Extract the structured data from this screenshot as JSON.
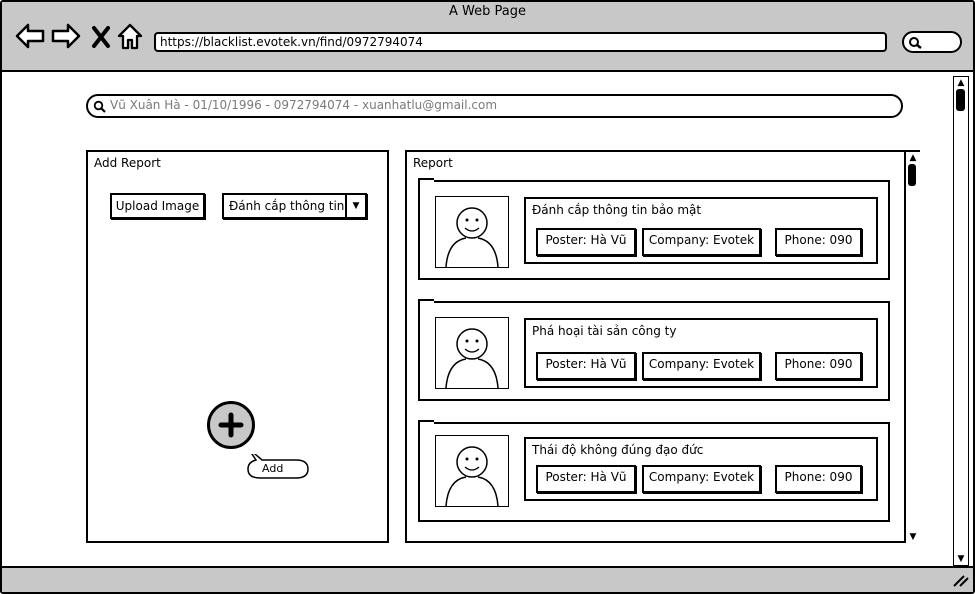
{
  "browser": {
    "title": "A Web Page",
    "url": "https://blacklist.evotek.vn/find/0972794074"
  },
  "search": {
    "value": "Vũ Xuân Hà - 01/10/1996 - 0972794074 - xuanhatlu@gmail.com"
  },
  "add_report": {
    "title": "Add Report",
    "upload_label": "Upload Image",
    "category_value": "Đánh cắp thông tin",
    "add_label": "Add"
  },
  "report": {
    "title": "Report",
    "items": [
      {
        "title": "Đánh cắp thông tin bảo mật",
        "poster": "Poster: Hà Vũ",
        "company": "Company: Evotek",
        "phone": "Phone: 090"
      },
      {
        "title": "Phá hoại tài sản công ty",
        "poster": "Poster: Hà Vũ",
        "company": "Company: Evotek",
        "phone": "Phone: 090"
      },
      {
        "title": "Thái độ không đúng đạo đức",
        "poster": "Poster: Hà Vũ",
        "company": "Company: Evotek",
        "phone": "Phone: 090"
      }
    ]
  },
  "icons": [
    "back-arrow-icon",
    "forward-arrow-icon",
    "close-icon",
    "home-icon",
    "search-icon",
    "plus-icon",
    "user-avatar-icon",
    "chevron-down-icon"
  ]
}
